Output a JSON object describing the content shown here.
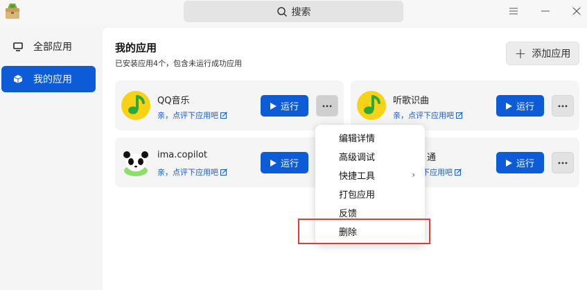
{
  "search": {
    "label": "搜索"
  },
  "sidebar": {
    "items": [
      {
        "label": "全部应用",
        "icon": "monitor-icon",
        "active": false
      },
      {
        "label": "我的应用",
        "icon": "box-icon",
        "active": true
      }
    ]
  },
  "main": {
    "title": "我的应用",
    "subtitle": "已安装应用4个，包含未运行成功应用",
    "add_label": "添加应用",
    "apps": [
      {
        "name": "QQ音乐",
        "rate": "亲，点评下应用吧",
        "run": "运行"
      },
      {
        "name": "听歌识曲",
        "rate": "亲，点评下应用吧",
        "run": "运行"
      },
      {
        "name": "ima.copilot",
        "rate": "亲，点评下应用吧",
        "run": "运行"
      },
      {
        "name": "通",
        "rate": "下应用吧",
        "run": "运行"
      }
    ]
  },
  "context_menu": {
    "items": [
      {
        "label": "编辑详情"
      },
      {
        "label": "高级调试"
      },
      {
        "label": "快捷工具",
        "submenu": true
      },
      {
        "label": "打包应用"
      },
      {
        "label": "反馈"
      },
      {
        "label": "删除"
      }
    ]
  },
  "colors": {
    "accent": "#0d5bd7",
    "highlight": "#e43a3a"
  }
}
